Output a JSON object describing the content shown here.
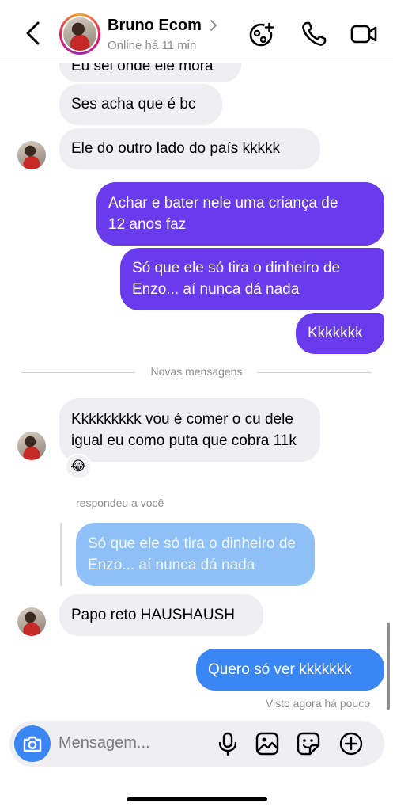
{
  "header": {
    "title": "Bruno Ecom",
    "status": "Online há 11 min"
  },
  "messages": {
    "m0": "Eu sei onde ele mora",
    "m1": "Ses acha que é bc",
    "m2": "Ele do outro lado do país kkkkk",
    "m3_line1": "Achar e bater nele uma criança de",
    "m3_line2": "12 anos faz",
    "m4_line1": "Só que ele só tira o dinheiro de",
    "m4_line2": "Enzo... aí nunca dá nada",
    "m5": "Kkkkkkk",
    "divider": "Novas mensagens",
    "m6_line1": "Kkkkkkkkk vou é comer o cu dele",
    "m6_line2": "igual eu como puta que cobra 11k",
    "m6_reaction": "😂",
    "replied_label": "respondeu a você",
    "quote_line1": "Só que ele só tira o dinheiro de",
    "quote_line2": "Enzo... aí nunca dá nada",
    "m7": "Papo reto HAUSHAUSH",
    "m8": "Quero só ver kkkkkkk",
    "seen": "Visto agora há pouco"
  },
  "composer": {
    "placeholder": "Mensagem..."
  },
  "icons": {
    "back": "chevron-left-icon",
    "effects": "effects-icon",
    "call": "phone-icon",
    "video": "video-icon",
    "camera": "camera-icon",
    "mic": "microphone-icon",
    "gallery": "gallery-icon",
    "sticker": "sticker-icon",
    "add": "plus-circle-icon"
  },
  "colors": {
    "outgoing": "#6a3bed",
    "outgoing_latest": "#3a86f5",
    "incoming": "#efeff3",
    "quote": "#8fc0f7"
  }
}
